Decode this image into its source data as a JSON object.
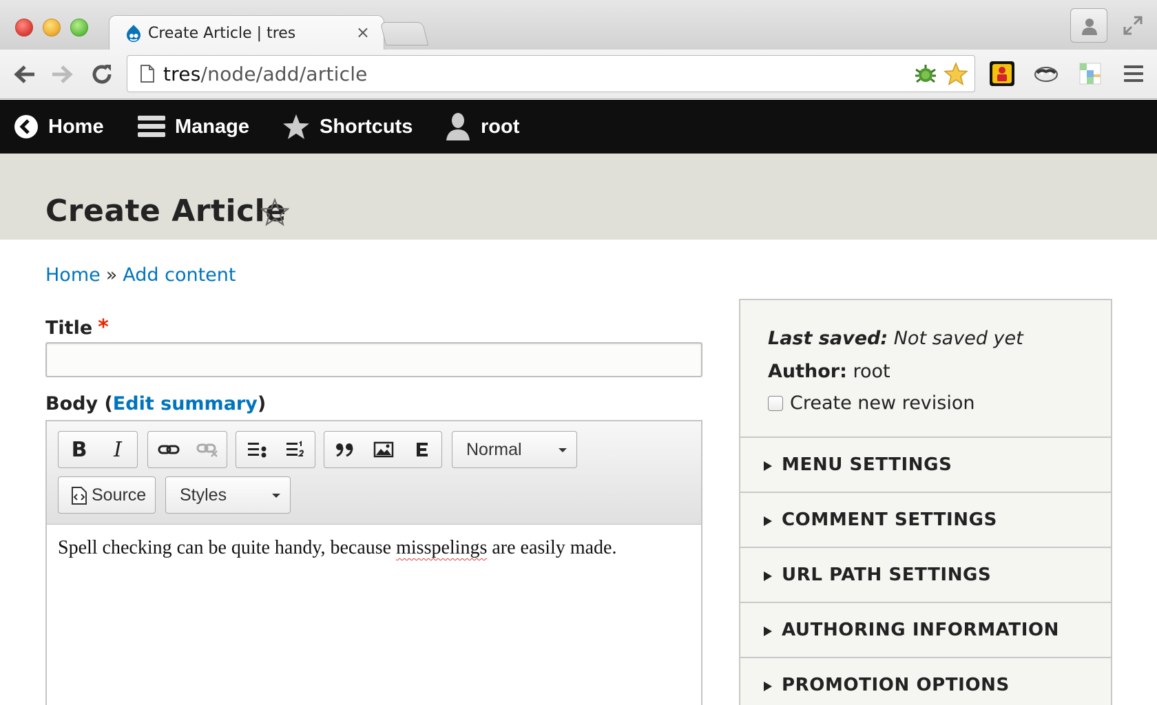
{
  "browser": {
    "tab_title": "Create Article | tres",
    "tab_close": "×",
    "url_host": "tres",
    "url_path": "/node/add/article"
  },
  "admin_toolbar": {
    "home": "Home",
    "manage": "Manage",
    "shortcuts": "Shortcuts",
    "user": "root"
  },
  "page": {
    "title": "Create Article",
    "breadcrumb": [
      {
        "label": "Home"
      },
      {
        "label": "Add content"
      }
    ],
    "breadcrumb_separator": "»"
  },
  "form": {
    "title_label": "Title",
    "required_marker": "*",
    "title_value": "",
    "body_label_prefix": "Body (",
    "body_edit_summary": "Edit summary",
    "body_label_suffix": ")",
    "editor": {
      "bold": "B",
      "italic": "I",
      "format_select": "Normal",
      "source_label": "Source",
      "styles_select": "Styles",
      "content_before": "Spell checking can be quite handy, because ",
      "content_misspelled": "misspelings",
      "content_after": " are easily made."
    }
  },
  "sidebar": {
    "last_saved_label": "Last saved:",
    "last_saved_value": "Not saved yet",
    "author_label": "Author:",
    "author_value": "root",
    "new_revision_label": "Create new revision",
    "new_revision_checked": false,
    "sections": [
      {
        "label": "MENU SETTINGS"
      },
      {
        "label": "COMMENT SETTINGS"
      },
      {
        "label": "URL PATH SETTINGS"
      },
      {
        "label": "AUTHORING INFORMATION"
      },
      {
        "label": "PROMOTION OPTIONS"
      }
    ]
  },
  "colors": {
    "link": "#0074bd",
    "required": "#e62600",
    "toolbar_bg": "#0f0f0f",
    "header_bg": "#e0e0d8"
  }
}
